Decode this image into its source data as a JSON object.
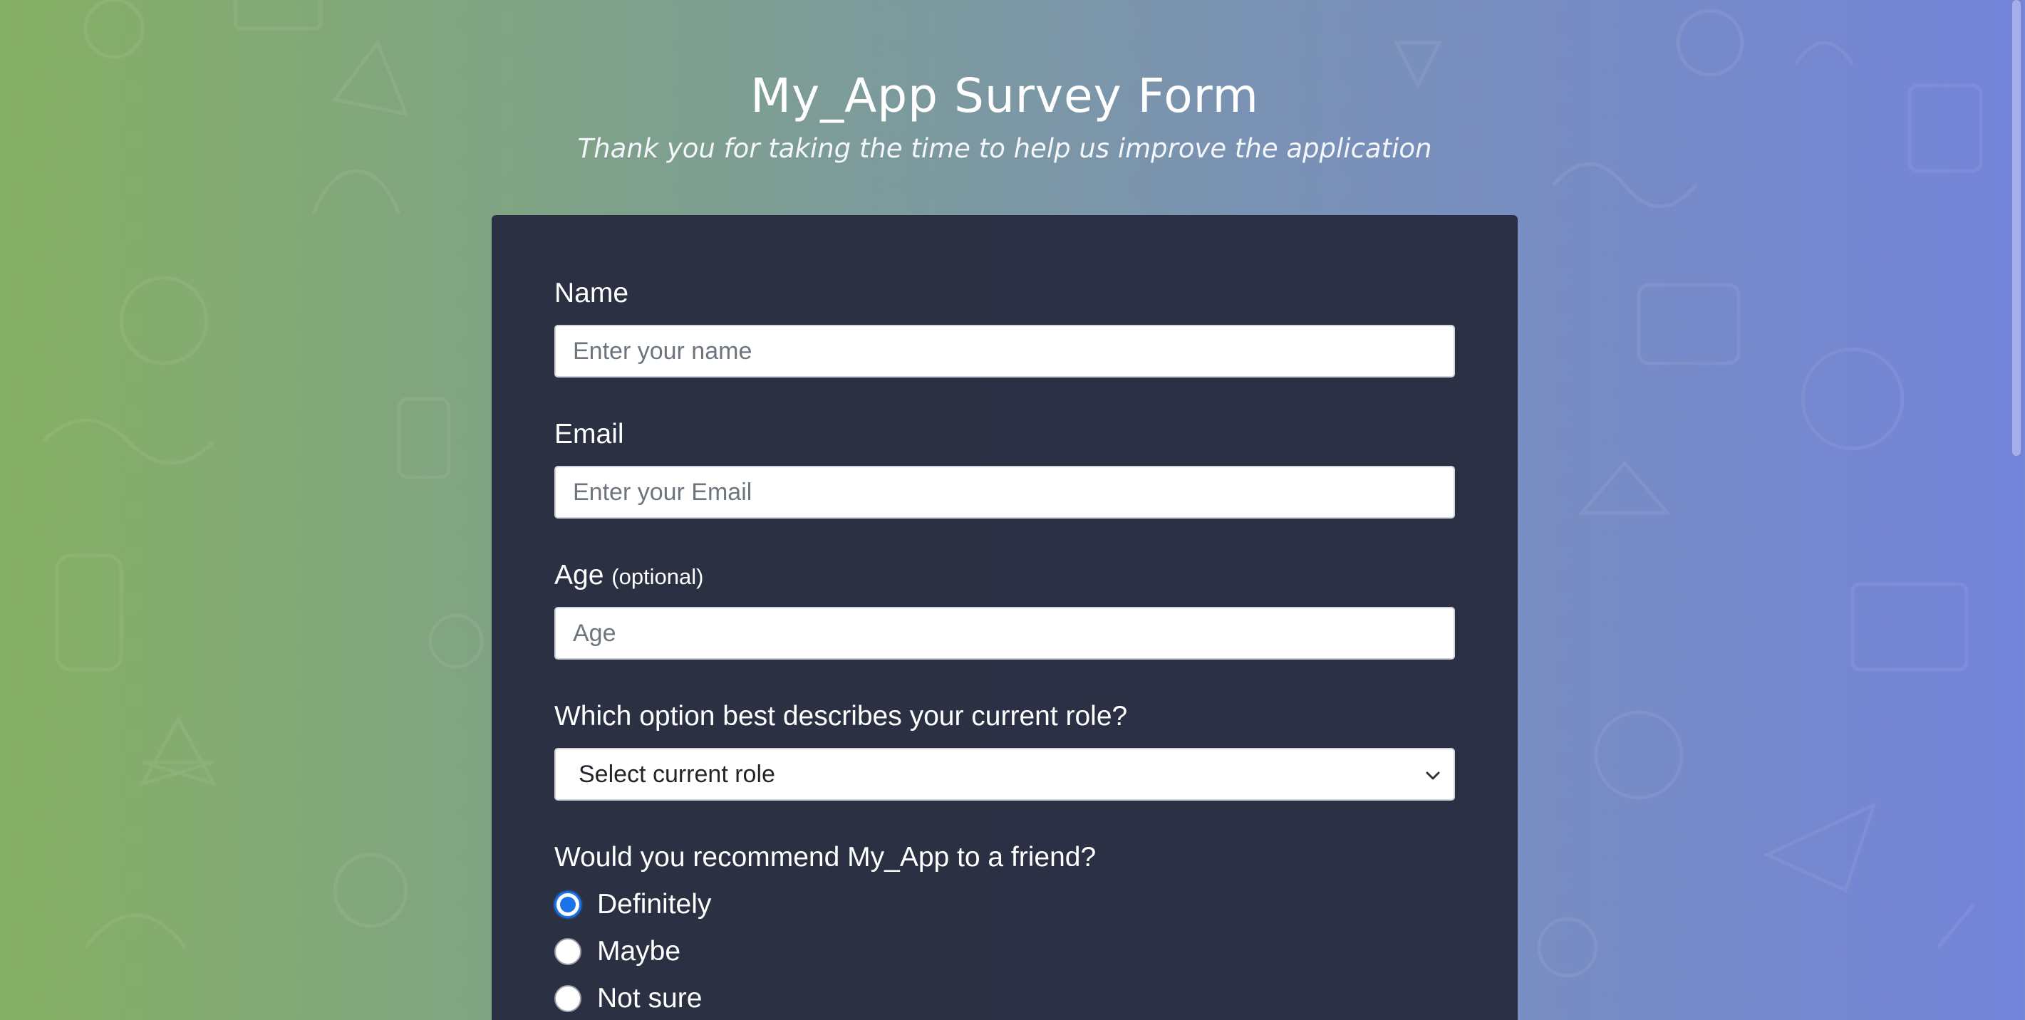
{
  "page": {
    "title": "My_App Survey Form",
    "subtitle": "Thank you for taking the time to help us improve the application"
  },
  "form": {
    "name": {
      "label": "Name",
      "placeholder": "Enter your name",
      "value": ""
    },
    "email": {
      "label": "Email",
      "placeholder": "Enter your Email",
      "value": ""
    },
    "age": {
      "label": "Age",
      "optional": "(optional)",
      "placeholder": "Age",
      "value": ""
    },
    "role": {
      "label": "Which option best describes your current role?",
      "selected": "Select current role"
    },
    "recommend": {
      "label": "Would you recommend My_App to a friend?",
      "options": [
        {
          "label": "Definitely",
          "checked": true
        },
        {
          "label": "Maybe",
          "checked": false
        },
        {
          "label": "Not sure",
          "checked": false
        }
      ]
    }
  },
  "colors": {
    "bg_left": "#86b064",
    "bg_right": "#7484da",
    "card": "#282c40",
    "radio_accent": "#1a73e8"
  },
  "icons": [
    "chevron-down-icon"
  ]
}
